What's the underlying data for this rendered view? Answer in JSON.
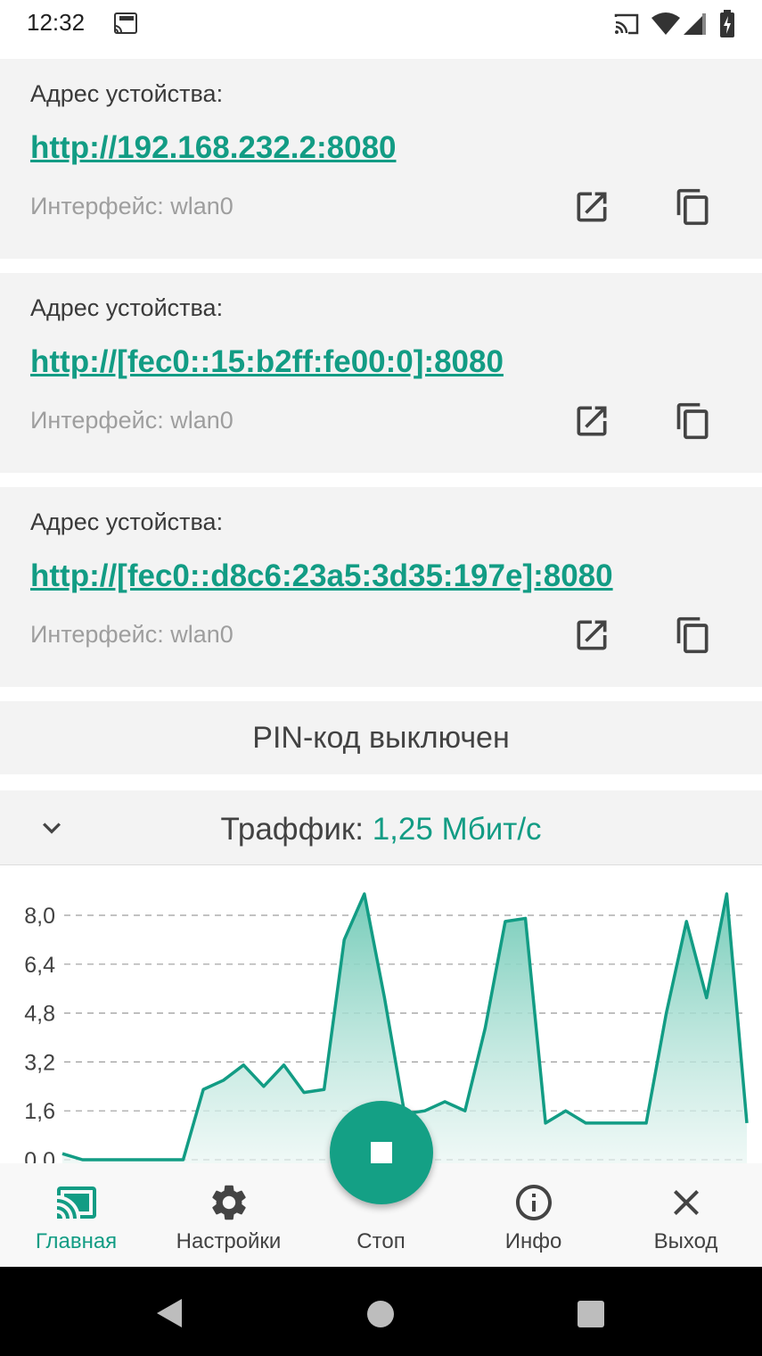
{
  "status_bar": {
    "time": "12:32",
    "icons": [
      "http-cast-icon",
      "cast-icon",
      "wifi-icon",
      "signal-icon",
      "battery-icon"
    ]
  },
  "addresses": [
    {
      "label": "Адрес устойства:",
      "url": "http://192.168.232.2:8080",
      "interface": "Интерфейс: wlan0"
    },
    {
      "label": "Адрес устойства:",
      "url": "http://[fec0::15:b2ff:fe00:0]:8080",
      "interface": "Интерфейс: wlan0"
    },
    {
      "label": "Адрес устойства:",
      "url": "http://[fec0::d8c6:23a5:3d35:197e]:8080",
      "interface": "Интерфейс: wlan0"
    }
  ],
  "pin_status": "PIN-код выключен",
  "traffic": {
    "label": "Траффик:",
    "value": "1,25 Мбит/с"
  },
  "chart_data": {
    "type": "area",
    "title": "",
    "xlabel": "",
    "ylabel": "",
    "ylim": [
      0,
      8.9
    ],
    "y_ticks": [
      "0,0",
      "1,6",
      "3,2",
      "4,8",
      "6,4",
      "8,0"
    ],
    "y_tick_values": [
      0,
      1.6,
      3.2,
      4.8,
      6.4,
      8.0
    ],
    "grid": "horizontal dashed",
    "series": [
      {
        "values": [
          0.2,
          0.0,
          0.0,
          0.0,
          0.0,
          0.0,
          0.0,
          2.3,
          2.6,
          3.1,
          2.4,
          3.1,
          2.2,
          2.3,
          7.2,
          8.7,
          5.3,
          1.5,
          1.6,
          1.9,
          1.6,
          4.3,
          7.8,
          7.9,
          1.2,
          1.6,
          1.2,
          1.2,
          1.2,
          1.2,
          4.8,
          7.8,
          5.3,
          8.7,
          1.2
        ]
      }
    ],
    "colors": {
      "line": "#129c84",
      "fill_top": "#6ec9b5",
      "fill_bottom": "#e9f6f3"
    }
  },
  "bottom_nav": {
    "items": [
      {
        "label": "Главная",
        "icon": "cast-screen-icon",
        "active": true
      },
      {
        "label": "Настройки",
        "icon": "gear-icon",
        "active": false
      },
      {
        "label": "Стоп",
        "icon": "stop-icon",
        "active": false
      },
      {
        "label": "Инфо",
        "icon": "info-icon",
        "active": false
      },
      {
        "label": "Выход",
        "icon": "close-icon",
        "active": false
      }
    ]
  },
  "colors": {
    "accent": "#129c84",
    "card_bg": "#f3f3f3",
    "fab": "#14a085"
  }
}
